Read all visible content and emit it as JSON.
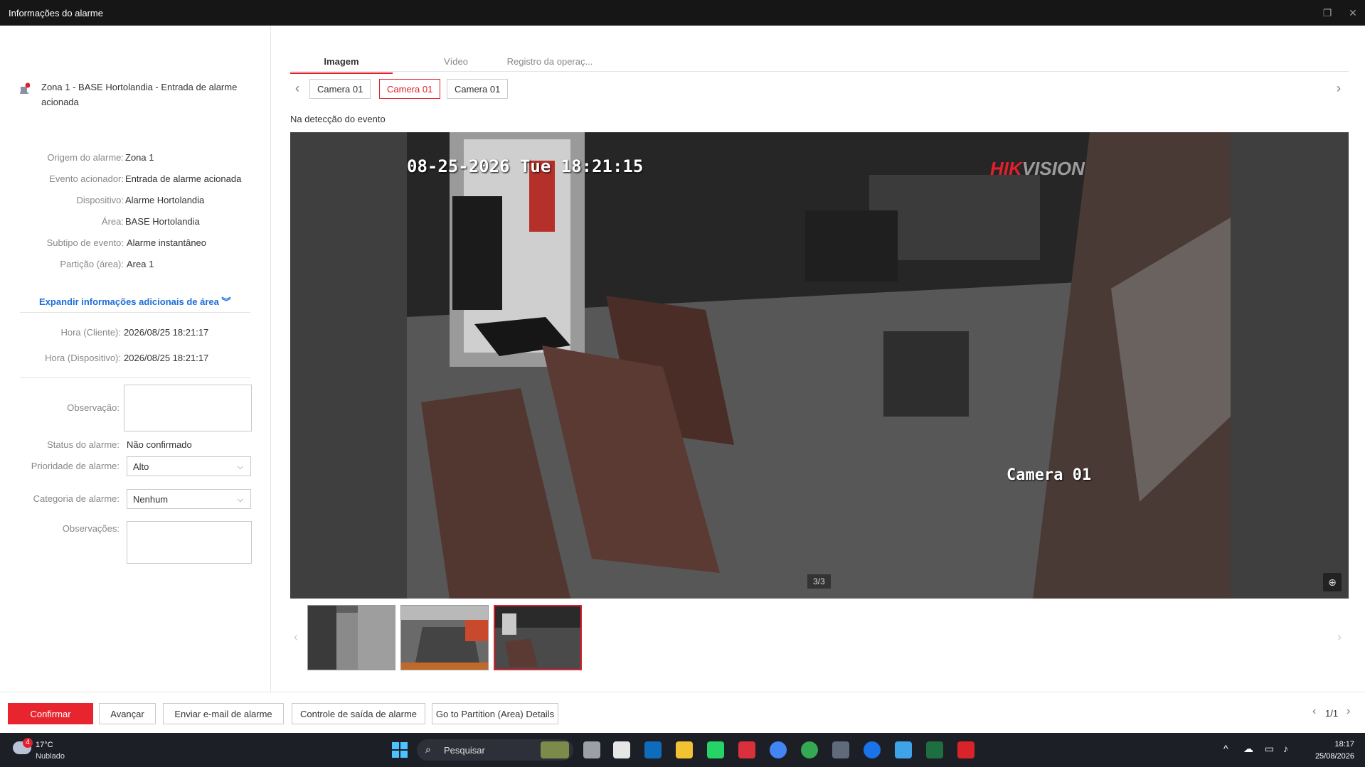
{
  "window": {
    "title": "Informações do alarme"
  },
  "zone": {
    "title": "Zona 1 - BASE Hortolandia - Entrada de alarme acionada"
  },
  "details": [
    {
      "label": "Origem do alarme:",
      "value": "Zona 1"
    },
    {
      "label": "Evento acionador:",
      "value": "Entrada de alarme acionada"
    },
    {
      "label": "Dispositivo:",
      "value": "Alarme Hortolandia"
    },
    {
      "label": "Área:",
      "value": "BASE Hortolandia"
    },
    {
      "label": "Subtipo de evento:",
      "value": "Alarme instantâneo"
    },
    {
      "label": "Partição (área):",
      "value": "Area 1"
    }
  ],
  "expand_label": "Expandir informações adicionais de área",
  "times": [
    {
      "label": "Hora (Cliente):",
      "value": "2026/08/25 18:21:17"
    },
    {
      "label": "Hora (Dispositivo):",
      "value": "2026/08/25 18:21:17"
    }
  ],
  "form": {
    "observacao_label": "Observação:",
    "status_label": "Status do alarme:",
    "status_value": "Não confirmado",
    "prioridade_label": "Prioridade de alarme:",
    "prioridade_value": "Alto",
    "categoria_label": "Categoria de alarme:",
    "categoria_value": "Nenhum",
    "observacoes_label": "Observações:"
  },
  "tabs": [
    "Imagem",
    "Vídeo",
    "Registro da operaç..."
  ],
  "cameras": [
    "Camera 01",
    "Camera 01",
    "Camera 01"
  ],
  "caption": "Na detecção do evento",
  "osd": {
    "timestamp": "08-25-2026 Tue 18:21:15",
    "camera": "Camera 01",
    "logo_a": "HIK",
    "logo_b": "VISION"
  },
  "counter": "3/3",
  "footer": {
    "confirm": "Confirmar",
    "advance": "Avançar",
    "email": "Enviar e-mail de alarme",
    "output": "Controle de saída de alarme",
    "partition": "Go to Partition (Area) Details",
    "pager": "1/1"
  },
  "taskbar": {
    "weather_badge": "4",
    "temperature": "17°C",
    "weather_text": "Nublado",
    "search_placeholder": "Pesquisar",
    "time": "18:17",
    "date": "25/08/2026"
  },
  "colors": {
    "accent": "#e0202d",
    "link": "#1b6dd8"
  }
}
